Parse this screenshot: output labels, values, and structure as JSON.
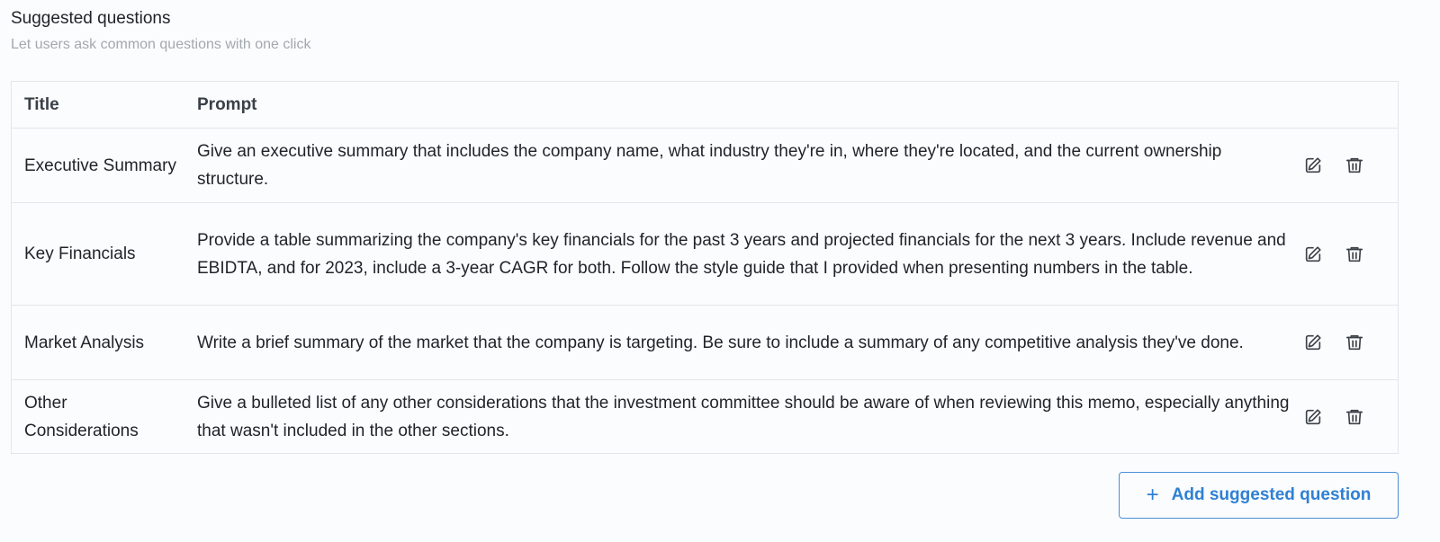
{
  "section": {
    "title": "Suggested questions",
    "subtitle": "Let users ask common questions with one click"
  },
  "table": {
    "columns": [
      "Title",
      "Prompt"
    ],
    "rows": [
      {
        "title": "Executive Summary",
        "prompt": "Give an executive summary that includes the company name, what industry they're in, where they're located, and the current ownership structure."
      },
      {
        "title": "Key Financials",
        "prompt": "Provide a table summarizing the company's key financials for the past 3 years and projected financials for the next 3 years. Include revenue and EBIDTA, and for 2023, include a 3-year CAGR for both. Follow the style guide that I provided when presenting numbers in the table."
      },
      {
        "title": "Market Analysis",
        "prompt": "Write a brief summary of the market that the company is targeting. Be sure to include a summary of any competitive analysis they've done."
      },
      {
        "title": "Other Considerations",
        "prompt": "Give a bulleted list of any other considerations that the investment committee should be aware of when reviewing this memo, especially anything that wasn't included in the other sections."
      }
    ],
    "row_actions": [
      "edit-icon",
      "trash-icon"
    ]
  },
  "add_button": {
    "icon": "plus-icon",
    "label": "Add suggested question"
  },
  "colors": {
    "accent": "#2f80d4",
    "border": "#e3e6ea",
    "muted_text": "#a3a8ae"
  }
}
